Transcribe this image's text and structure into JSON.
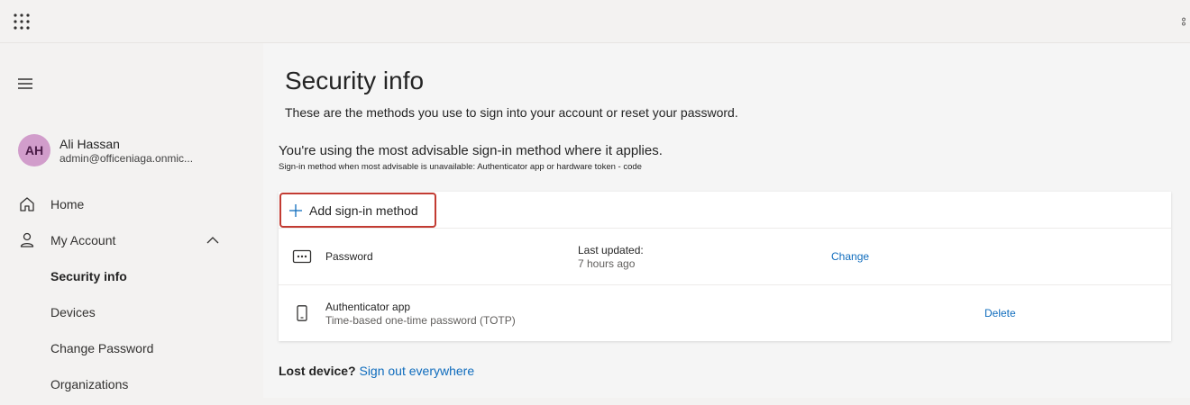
{
  "icons": {
    "apps": "waffle-icon",
    "menu": "hamburger-icon",
    "home": "home-icon",
    "account": "person-icon",
    "expand": "chevron-up-icon",
    "add": "plus-icon",
    "password": "password-dots-icon",
    "authenticator": "phone-icon"
  },
  "colors": {
    "accent_link": "#0f6cbd",
    "highlight_border": "#c23b32",
    "avatar_bg": "#d19dcb"
  },
  "profile": {
    "initials": "AH",
    "name": "Ali Hassan",
    "email": "admin@officeniaga.onmic..."
  },
  "sidebar": {
    "items": [
      {
        "label": "Home"
      },
      {
        "label": "My Account"
      },
      {
        "label": "Security info"
      },
      {
        "label": "Devices"
      },
      {
        "label": "Change Password"
      },
      {
        "label": "Organizations"
      }
    ]
  },
  "main": {
    "title": "Security info",
    "subtitle": "These are the methods you use to sign into your account or reset your password.",
    "advisable": "You're using the most advisable sign-in method where it applies.",
    "advisable_note": "Sign-in method when most advisable is unavailable: Authenticator app or hardware token - code",
    "add_method_label": "Add sign-in method",
    "methods": [
      {
        "name": "Password",
        "updated_label": "Last updated:",
        "updated_value": "7 hours ago",
        "action": "Change"
      },
      {
        "name": "Authenticator app",
        "detail": "Time-based one-time password (TOTP)",
        "action": "Delete"
      }
    ],
    "lost_device_label": "Lost device?",
    "sign_out_link": "Sign out everywhere"
  }
}
